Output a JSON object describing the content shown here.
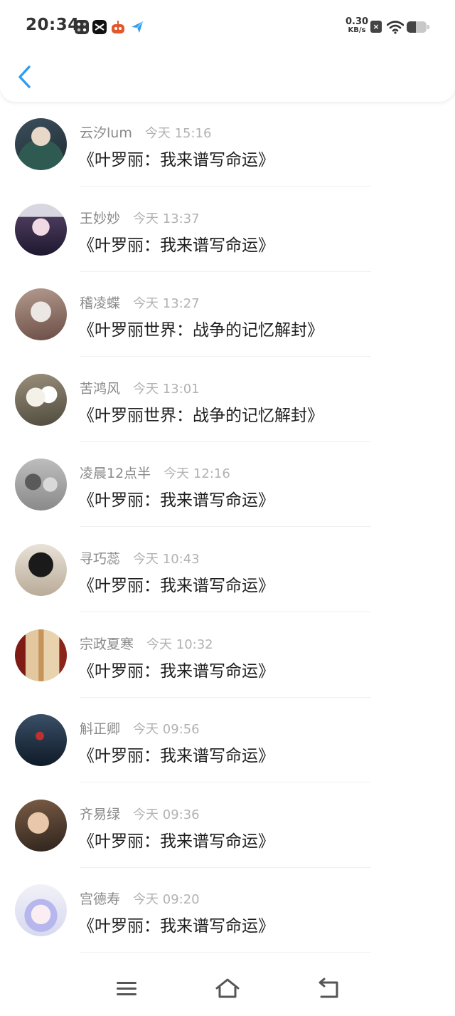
{
  "status_bar": {
    "time": "20:34",
    "net_speed_value": "0.30",
    "net_speed_unit": "KB/s",
    "sim_status": "×",
    "icons": [
      "gallery-app-icon",
      "capcut-app-icon",
      "game-app-icon",
      "send-app-icon",
      "sim-off-icon",
      "wifi-icon",
      "battery-icon"
    ],
    "battery_level": 0.45
  },
  "header": {
    "back_icon": "chevron-left-icon",
    "accent_color": "#2d9cf0"
  },
  "comments": [
    {
      "user": "云汐lum",
      "time": "今天 15:16",
      "title": "《叶罗丽：我来谱写命运》"
    },
    {
      "user": "王妙妙",
      "time": "今天 13:37",
      "title": "《叶罗丽：我来谱写命运》"
    },
    {
      "user": "稽凌蝶",
      "time": "今天 13:27",
      "title": "《叶罗丽世界：战争的记忆解封》"
    },
    {
      "user": "苦鸿风",
      "time": "今天 13:01",
      "title": "《叶罗丽世界：战争的记忆解封》"
    },
    {
      "user": "凌晨12点半",
      "time": "今天 12:16",
      "title": "《叶罗丽：我来谱写命运》"
    },
    {
      "user": "寻巧蕊",
      "time": "今天 10:43",
      "title": "《叶罗丽：我来谱写命运》"
    },
    {
      "user": "宗政夏寒",
      "time": "今天 10:32",
      "title": "《叶罗丽：我来谱写命运》"
    },
    {
      "user": "斛正卿",
      "time": "今天 09:56",
      "title": "《叶罗丽：我来谱写命运》"
    },
    {
      "user": "齐易绿",
      "time": "今天 09:36",
      "title": "《叶罗丽：我来谱写命运》"
    },
    {
      "user": "宫德寿",
      "time": "今天 09:20",
      "title": "《叶罗丽：我来谱写命运》"
    }
  ],
  "nav_bar": {
    "icons": [
      "menu-icon",
      "home-icon",
      "back-icon"
    ]
  }
}
